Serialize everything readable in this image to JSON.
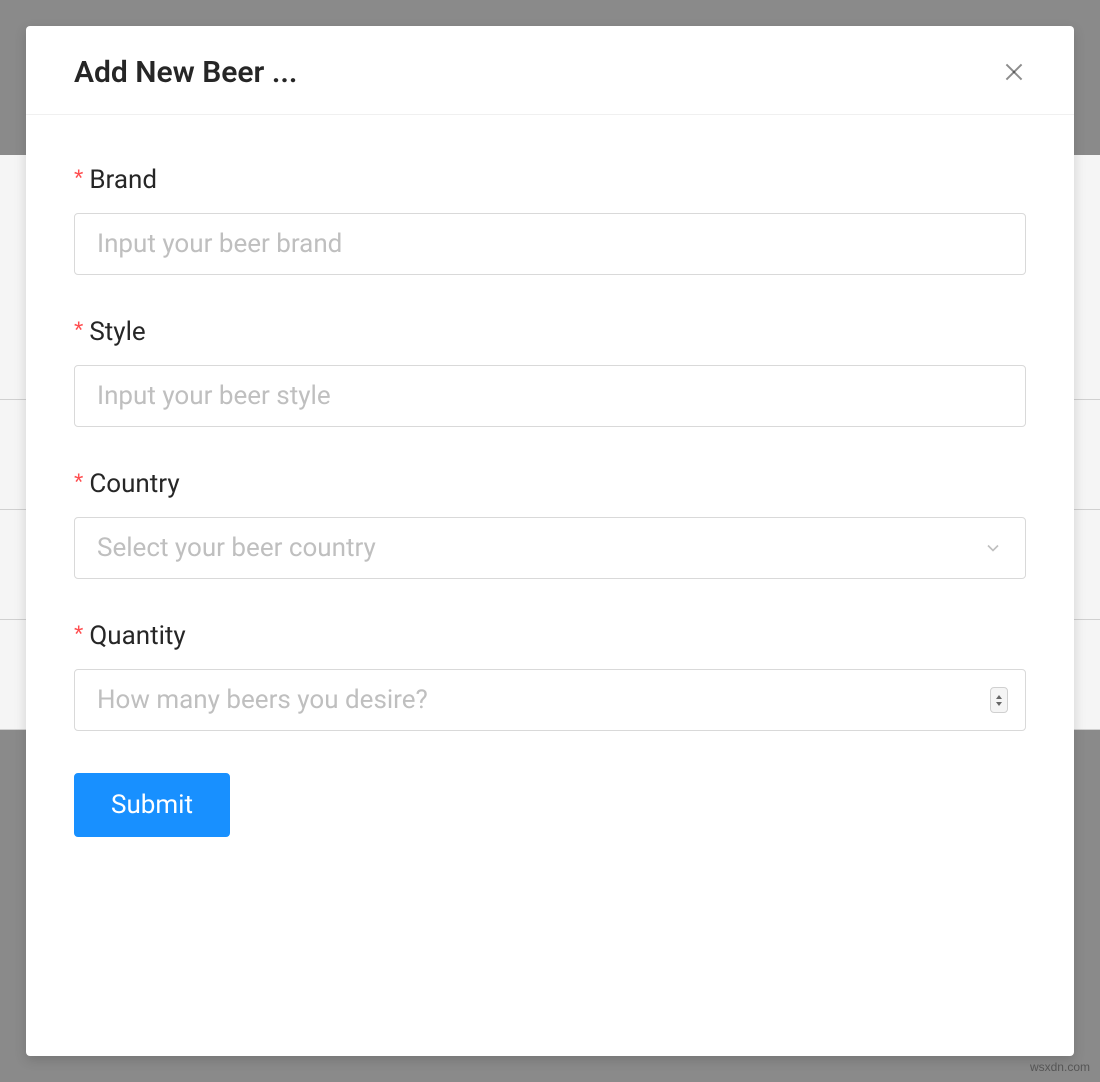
{
  "modal": {
    "title": "Add New Beer ...",
    "close_icon": "close-icon"
  },
  "form": {
    "fields": {
      "brand": {
        "label": "Brand",
        "placeholder": "Input your beer brand",
        "required": true
      },
      "style": {
        "label": "Style",
        "placeholder": "Input your beer style",
        "required": true
      },
      "country": {
        "label": "Country",
        "placeholder": "Select your beer country",
        "required": true
      },
      "quantity": {
        "label": "Quantity",
        "placeholder": "How many beers you desire?",
        "required": true
      }
    },
    "submit_label": "Submit"
  },
  "required_mark": "*",
  "watermark": "wsxdn.com"
}
